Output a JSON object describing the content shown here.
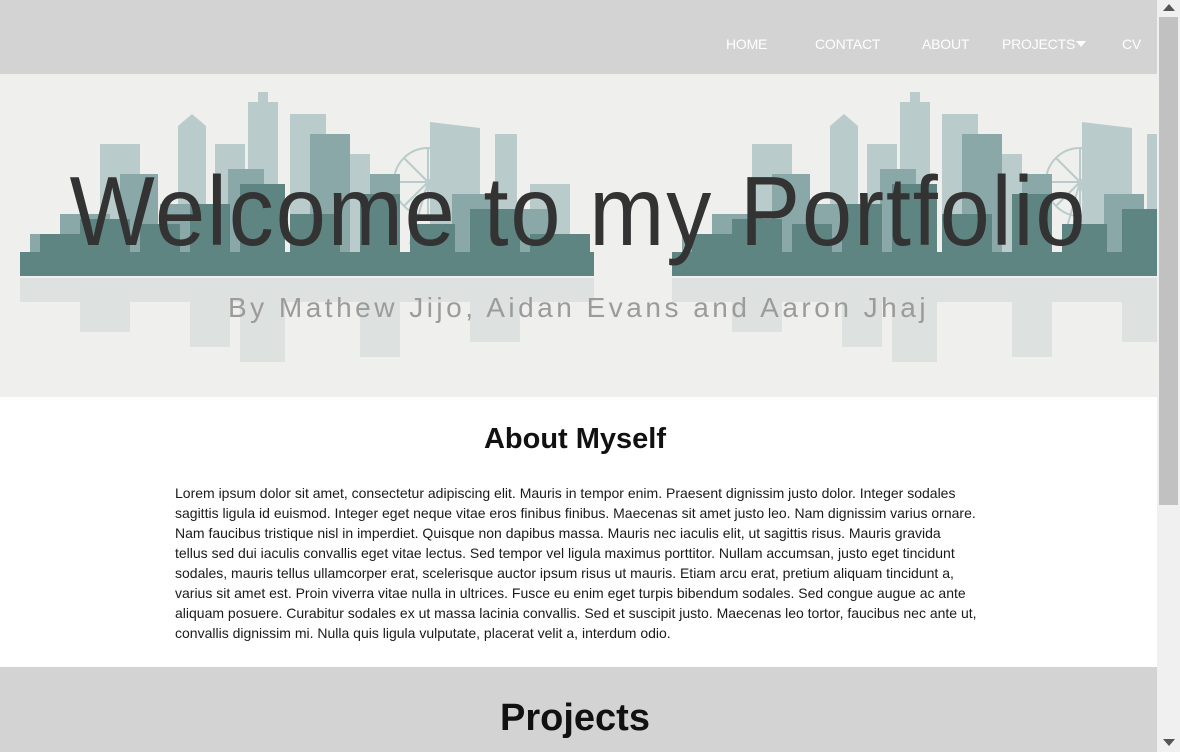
{
  "nav": {
    "home": "HOME",
    "contact": "CONTACT",
    "about": "ABOUT",
    "projects": "PROJECTS",
    "cv": "CV"
  },
  "hero": {
    "title": "Welcome to my Portfolio",
    "subtitle": "By Mathew Jijo, Aidan Evans and Aaron Jhaj"
  },
  "about": {
    "heading": "About Myself",
    "body": "Lorem ipsum dolor sit amet, consectetur adipiscing elit. Mauris in tempor enim. Praesent dignissim justo dolor. Integer sodales sagittis ligula id euismod. Integer eget neque vitae eros finibus finibus. Maecenas sit amet justo leo. Nam dignissim varius ornare. Nam faucibus tristique nisl in imperdiet. Quisque non dapibus massa. Mauris nec iaculis elit, ut sagittis risus. Mauris gravida tellus sed dui iaculis convallis eget vitae lectus. Sed tempor vel ligula maximus porttitor. Nullam accumsan, justo eget tincidunt sodales, mauris tellus ullamcorper erat, scelerisque auctor ipsum risus ut mauris. Etiam arcu erat, pretium aliquam tincidunt a, varius sit amet est. Proin viverra vitae nulla in ultrices. Fusce eu enim eget turpis bibendum sodales. Sed congue augue ac ante aliquam posuere. Curabitur sodales ex ut massa lacinia convallis. Sed et suscipit justo. Maecenas leo tortor, faucibus nec ante ut, convallis dignissim mi. Nulla quis ligula vulputate, placerat velit a, interdum odio."
  },
  "projects": {
    "heading": "Projects"
  },
  "colors": {
    "nav_bg": "#d3d3d3",
    "hero_bg": "#efefed",
    "skyline_dark": "#5f8583",
    "skyline_mid": "#8aa8a7",
    "skyline_light": "#b9cccb"
  }
}
